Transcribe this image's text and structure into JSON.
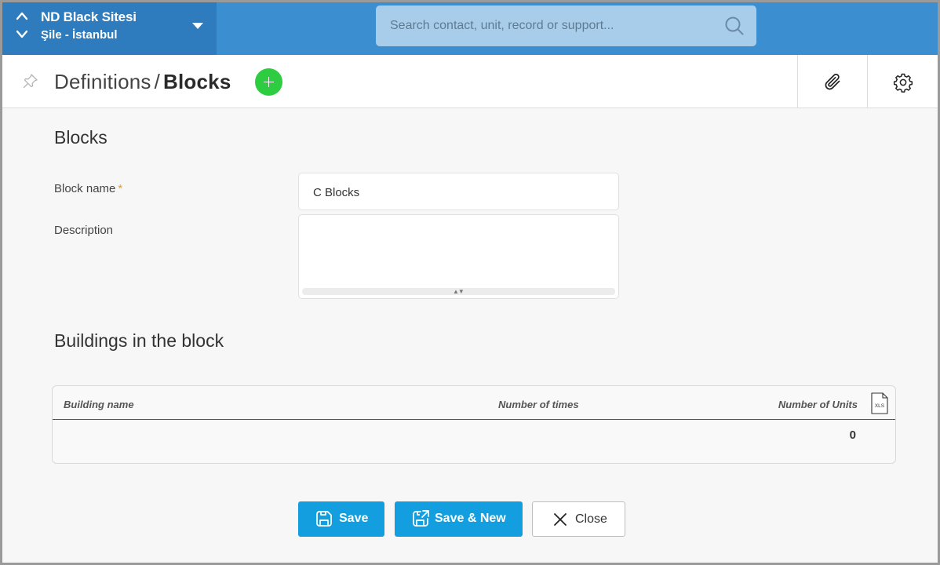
{
  "site": {
    "name": "ND Black Sitesi",
    "location": "Şile - İstanbul"
  },
  "search": {
    "placeholder": "Search contact, unit, record or support..."
  },
  "breadcrumb": {
    "parent": "Definitions",
    "separator": "/",
    "current": "Blocks"
  },
  "form": {
    "section_title": "Blocks",
    "block_name_label": "Block name",
    "required_mark": "*",
    "block_name_value": "C Blocks",
    "description_label": "Description",
    "description_value": ""
  },
  "buildings": {
    "section_title": "Buildings in the block",
    "columns": [
      "Building name",
      "Number of times",
      "Number of Units"
    ],
    "rows": [
      {
        "building_name": "",
        "number_of_times": "",
        "number_of_units": "0"
      }
    ]
  },
  "actions": {
    "save_label": "Save",
    "save_new_label": "Save & New",
    "close_label": "Close"
  },
  "icons": {
    "site_up": "chevron-up-icon",
    "site_down": "chevron-down-icon",
    "search": "search-icon",
    "pin": "pin-icon",
    "add": "plus-icon",
    "attach": "paperclip-icon",
    "settings": "gear-icon",
    "export": "xls-file-icon",
    "save": "floppy-disk-icon",
    "save_new": "floppy-export-icon",
    "close": "close-icon"
  },
  "colors": {
    "topbar": "#3b8fd1",
    "site_switch": "#2e7bbd",
    "search_bg": "#a8cdea",
    "add_button": "#2ecc40",
    "primary_button": "#139fdf",
    "required": "#f0a000"
  }
}
